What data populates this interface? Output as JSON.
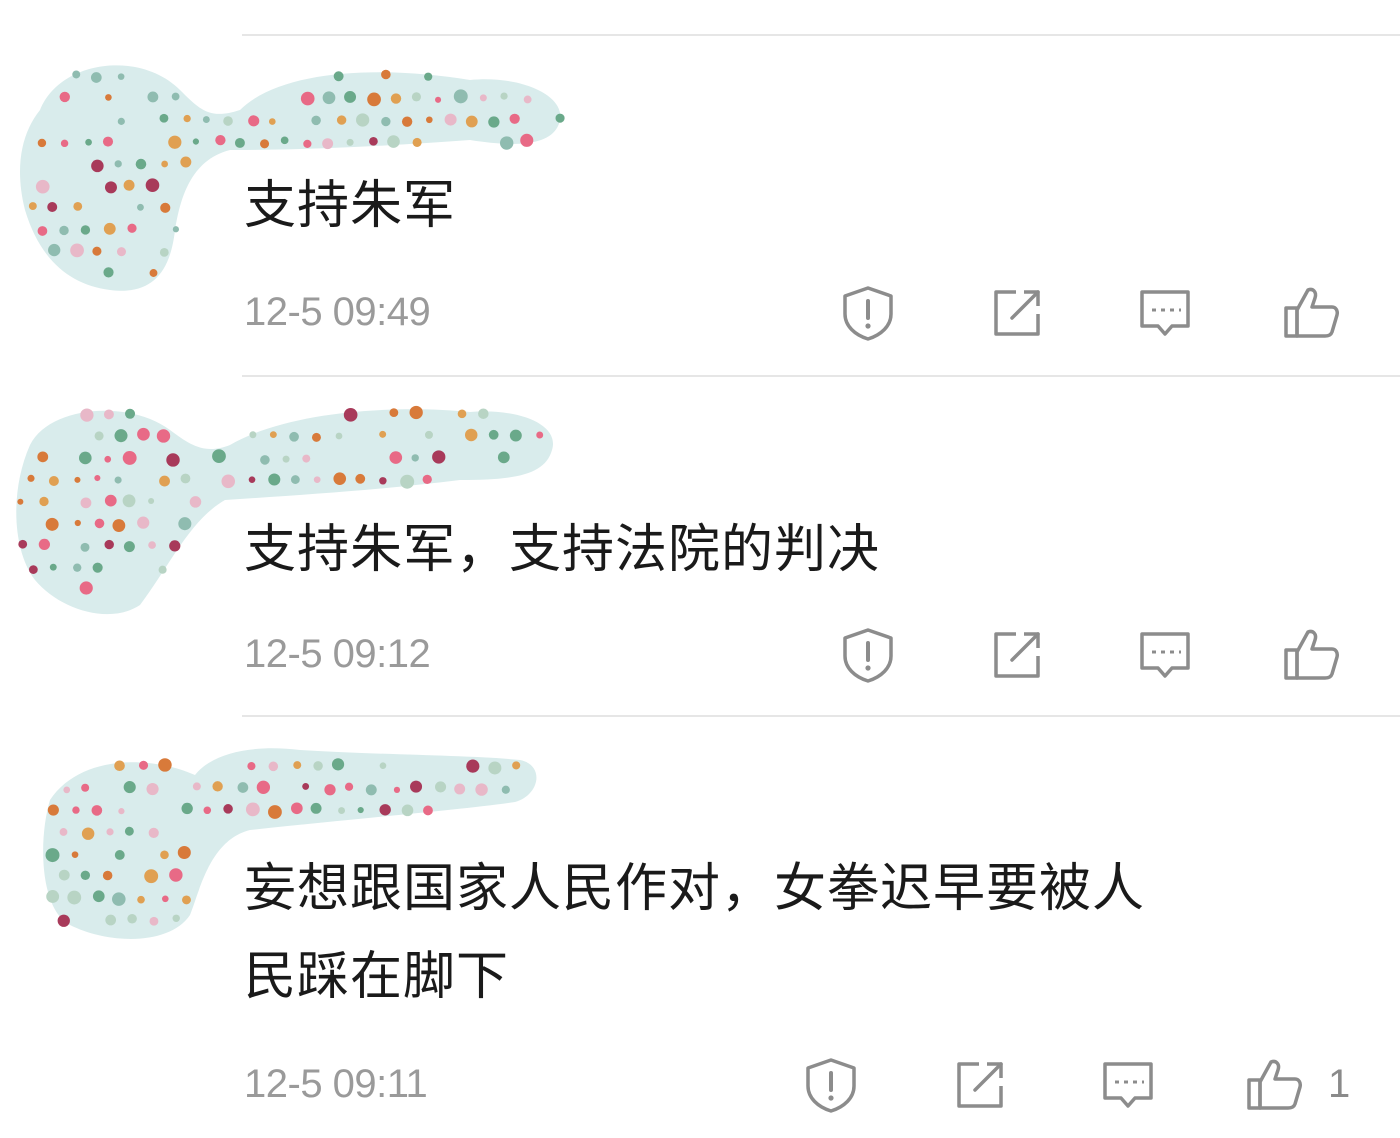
{
  "colors": {
    "text": "#1a1a1a",
    "meta": "#9a9a9a",
    "icon": "#8c8c8c",
    "mask_bg": "#d9ecec",
    "divider": "#e6e6e6"
  },
  "mask_dot_colors": [
    "#e0a052",
    "#6aa98a",
    "#e86a86",
    "#8fbcb0",
    "#a83a5a",
    "#b8d4c4",
    "#e8b8c8",
    "#d87a3a"
  ],
  "actions": [
    {
      "name": "report",
      "icon": "shield-alert-icon"
    },
    {
      "name": "share",
      "icon": "share-out-icon"
    },
    {
      "name": "reply",
      "icon": "comment-bubble-icon"
    },
    {
      "name": "like",
      "icon": "thumbs-up-icon"
    }
  ],
  "comments": [
    {
      "text": "支持朱军",
      "time": "12-5 09:49",
      "like_count": ""
    },
    {
      "text": "支持朱军，支持法院的判决",
      "time": "12-5 09:12",
      "like_count": ""
    },
    {
      "text_line1": "妄想跟国家人民作对，女拳迟早要被人",
      "text_line2": "民踩在脚下",
      "time": "12-5 09:11",
      "like_count": "1"
    }
  ]
}
